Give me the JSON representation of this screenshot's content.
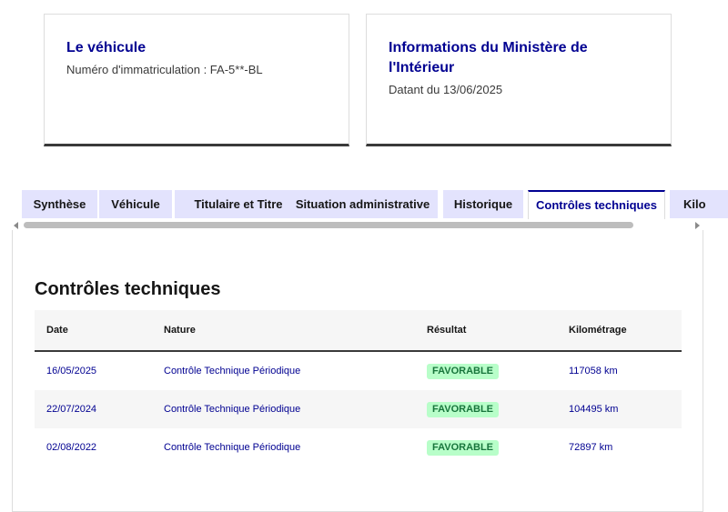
{
  "cards": [
    {
      "title": "Le véhicule",
      "desc": "Numéro d'immatriculation : FA-5**-BL"
    },
    {
      "title": "Informations du Ministère de l'Intérieur",
      "desc": "Datant du 13/06/2025"
    }
  ],
  "tabs": [
    {
      "label": "Synthèse"
    },
    {
      "label": "Véhicule"
    },
    {
      "label": "Titulaire et Titre"
    },
    {
      "label": "Situation administrative"
    },
    {
      "label": "Historique"
    },
    {
      "label": "Contrôles techniques"
    },
    {
      "label": "Kilo"
    }
  ],
  "active_tab_index": 5,
  "section": {
    "title": "Contrôles techniques",
    "columns": [
      "Date",
      "Nature",
      "Résultat",
      "Kilométrage"
    ],
    "rows": [
      {
        "date": "16/05/2025",
        "nature": "Contrôle Technique Périodique",
        "result": "FAVORABLE",
        "km": "117058 km"
      },
      {
        "date": "22/07/2024",
        "nature": "Contrôle Technique Périodique",
        "result": "FAVORABLE",
        "km": "104495 km"
      },
      {
        "date": "02/08/2022",
        "nature": "Contrôle Technique Périodique",
        "result": "FAVORABLE",
        "km": "72897 km"
      }
    ]
  },
  "colors": {
    "accent": "#000091",
    "tab_background": "#e3e3fd",
    "badge_background": "#b8fec9",
    "badge_text": "#18753c"
  }
}
